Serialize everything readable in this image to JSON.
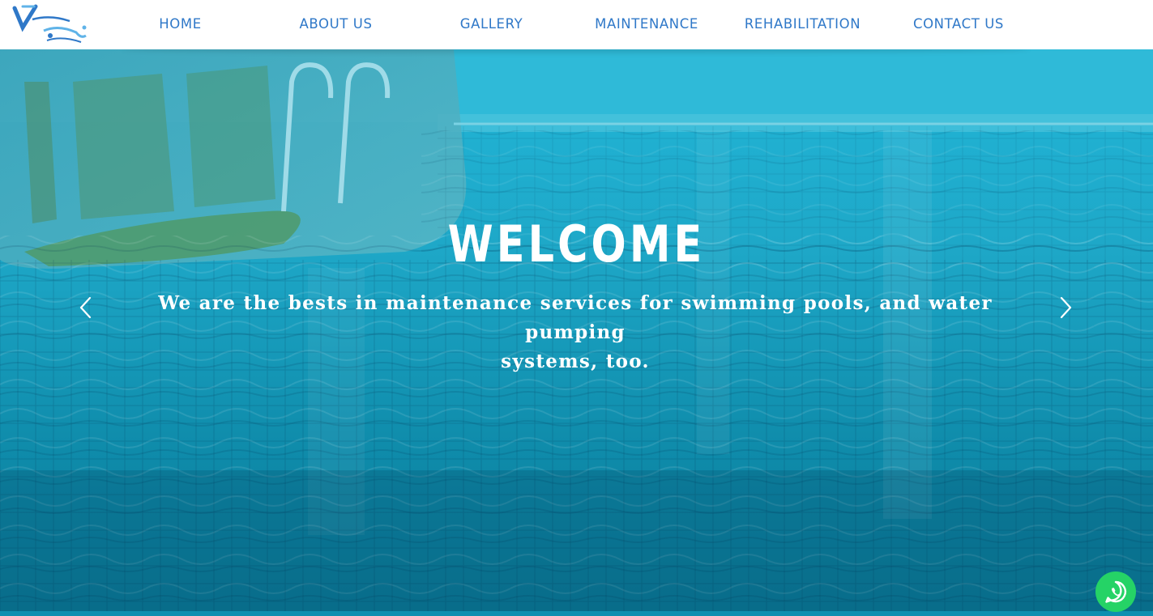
{
  "nav": {
    "logo_alt": "Venezia Pools",
    "items": [
      {
        "label": "HOME"
      },
      {
        "label": "ABOUT US"
      },
      {
        "label": "GALLERY"
      },
      {
        "label": "MAINTENANCE"
      },
      {
        "label": "REHABILITATION"
      },
      {
        "label": "CONTACT US"
      }
    ]
  },
  "hero": {
    "title": "WELCOME",
    "tagline_line1": "We are the bests in maintenance services for swimming pools, and water pumping",
    "tagline_line2": "systems, too."
  },
  "colors": {
    "nav_text": "#2f78c8",
    "hero_water": "#0e8fb0",
    "whatsapp": "#25d366"
  },
  "icons": {
    "prev": "chevron-left-icon",
    "next": "chevron-right-icon",
    "chat": "whatsapp-icon"
  }
}
